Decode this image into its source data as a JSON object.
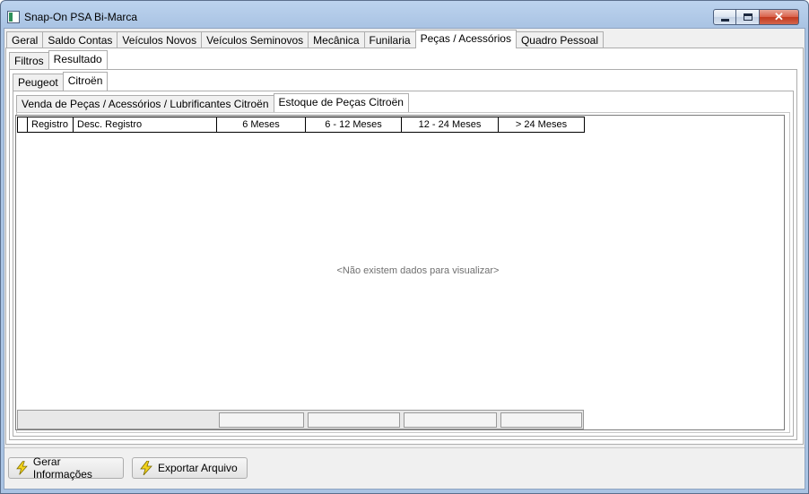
{
  "window": {
    "title": "Snap-On PSA Bi-Marca",
    "minimize": "minimize",
    "maximize": "maximize",
    "close": "✕"
  },
  "main_tabs": [
    {
      "label": "Geral",
      "active": false
    },
    {
      "label": "Saldo Contas",
      "active": false
    },
    {
      "label": "Veículos Novos",
      "active": false
    },
    {
      "label": "Veículos Seminovos",
      "active": false
    },
    {
      "label": "Mecânica",
      "active": false
    },
    {
      "label": "Funilaria",
      "active": false
    },
    {
      "label": "Peças / Acessórios",
      "active": true
    },
    {
      "label": "Quadro Pessoal",
      "active": false
    }
  ],
  "sub_tabs": [
    {
      "label": "Filtros",
      "active": false
    },
    {
      "label": "Resultado",
      "active": true
    }
  ],
  "brand_tabs": [
    {
      "label": "Peugeot",
      "active": false
    },
    {
      "label": "Citroën",
      "active": true
    }
  ],
  "report_tabs": [
    {
      "label": "Venda de Peças / Acessórios / Lubrificantes Citroën",
      "active": false
    },
    {
      "label": "Estoque de Peças Citroën",
      "active": true
    }
  ],
  "grid": {
    "columns": [
      "",
      "Registro",
      "Desc. Registro",
      "6 Meses",
      "6 - 12 Meses",
      "12 - 24 Meses",
      "> 24 Meses"
    ],
    "empty_message": "<Não existem dados para visualizar>"
  },
  "buttons": {
    "generate": "Gerar Informações",
    "export": "Exportar Arquivo"
  },
  "colors": {
    "titlebar": "#a9c3e3",
    "bolt": "#f2d21b"
  },
  "icons": {
    "generate": "lightning-bolt-icon",
    "export": "lightning-bolt-icon"
  }
}
